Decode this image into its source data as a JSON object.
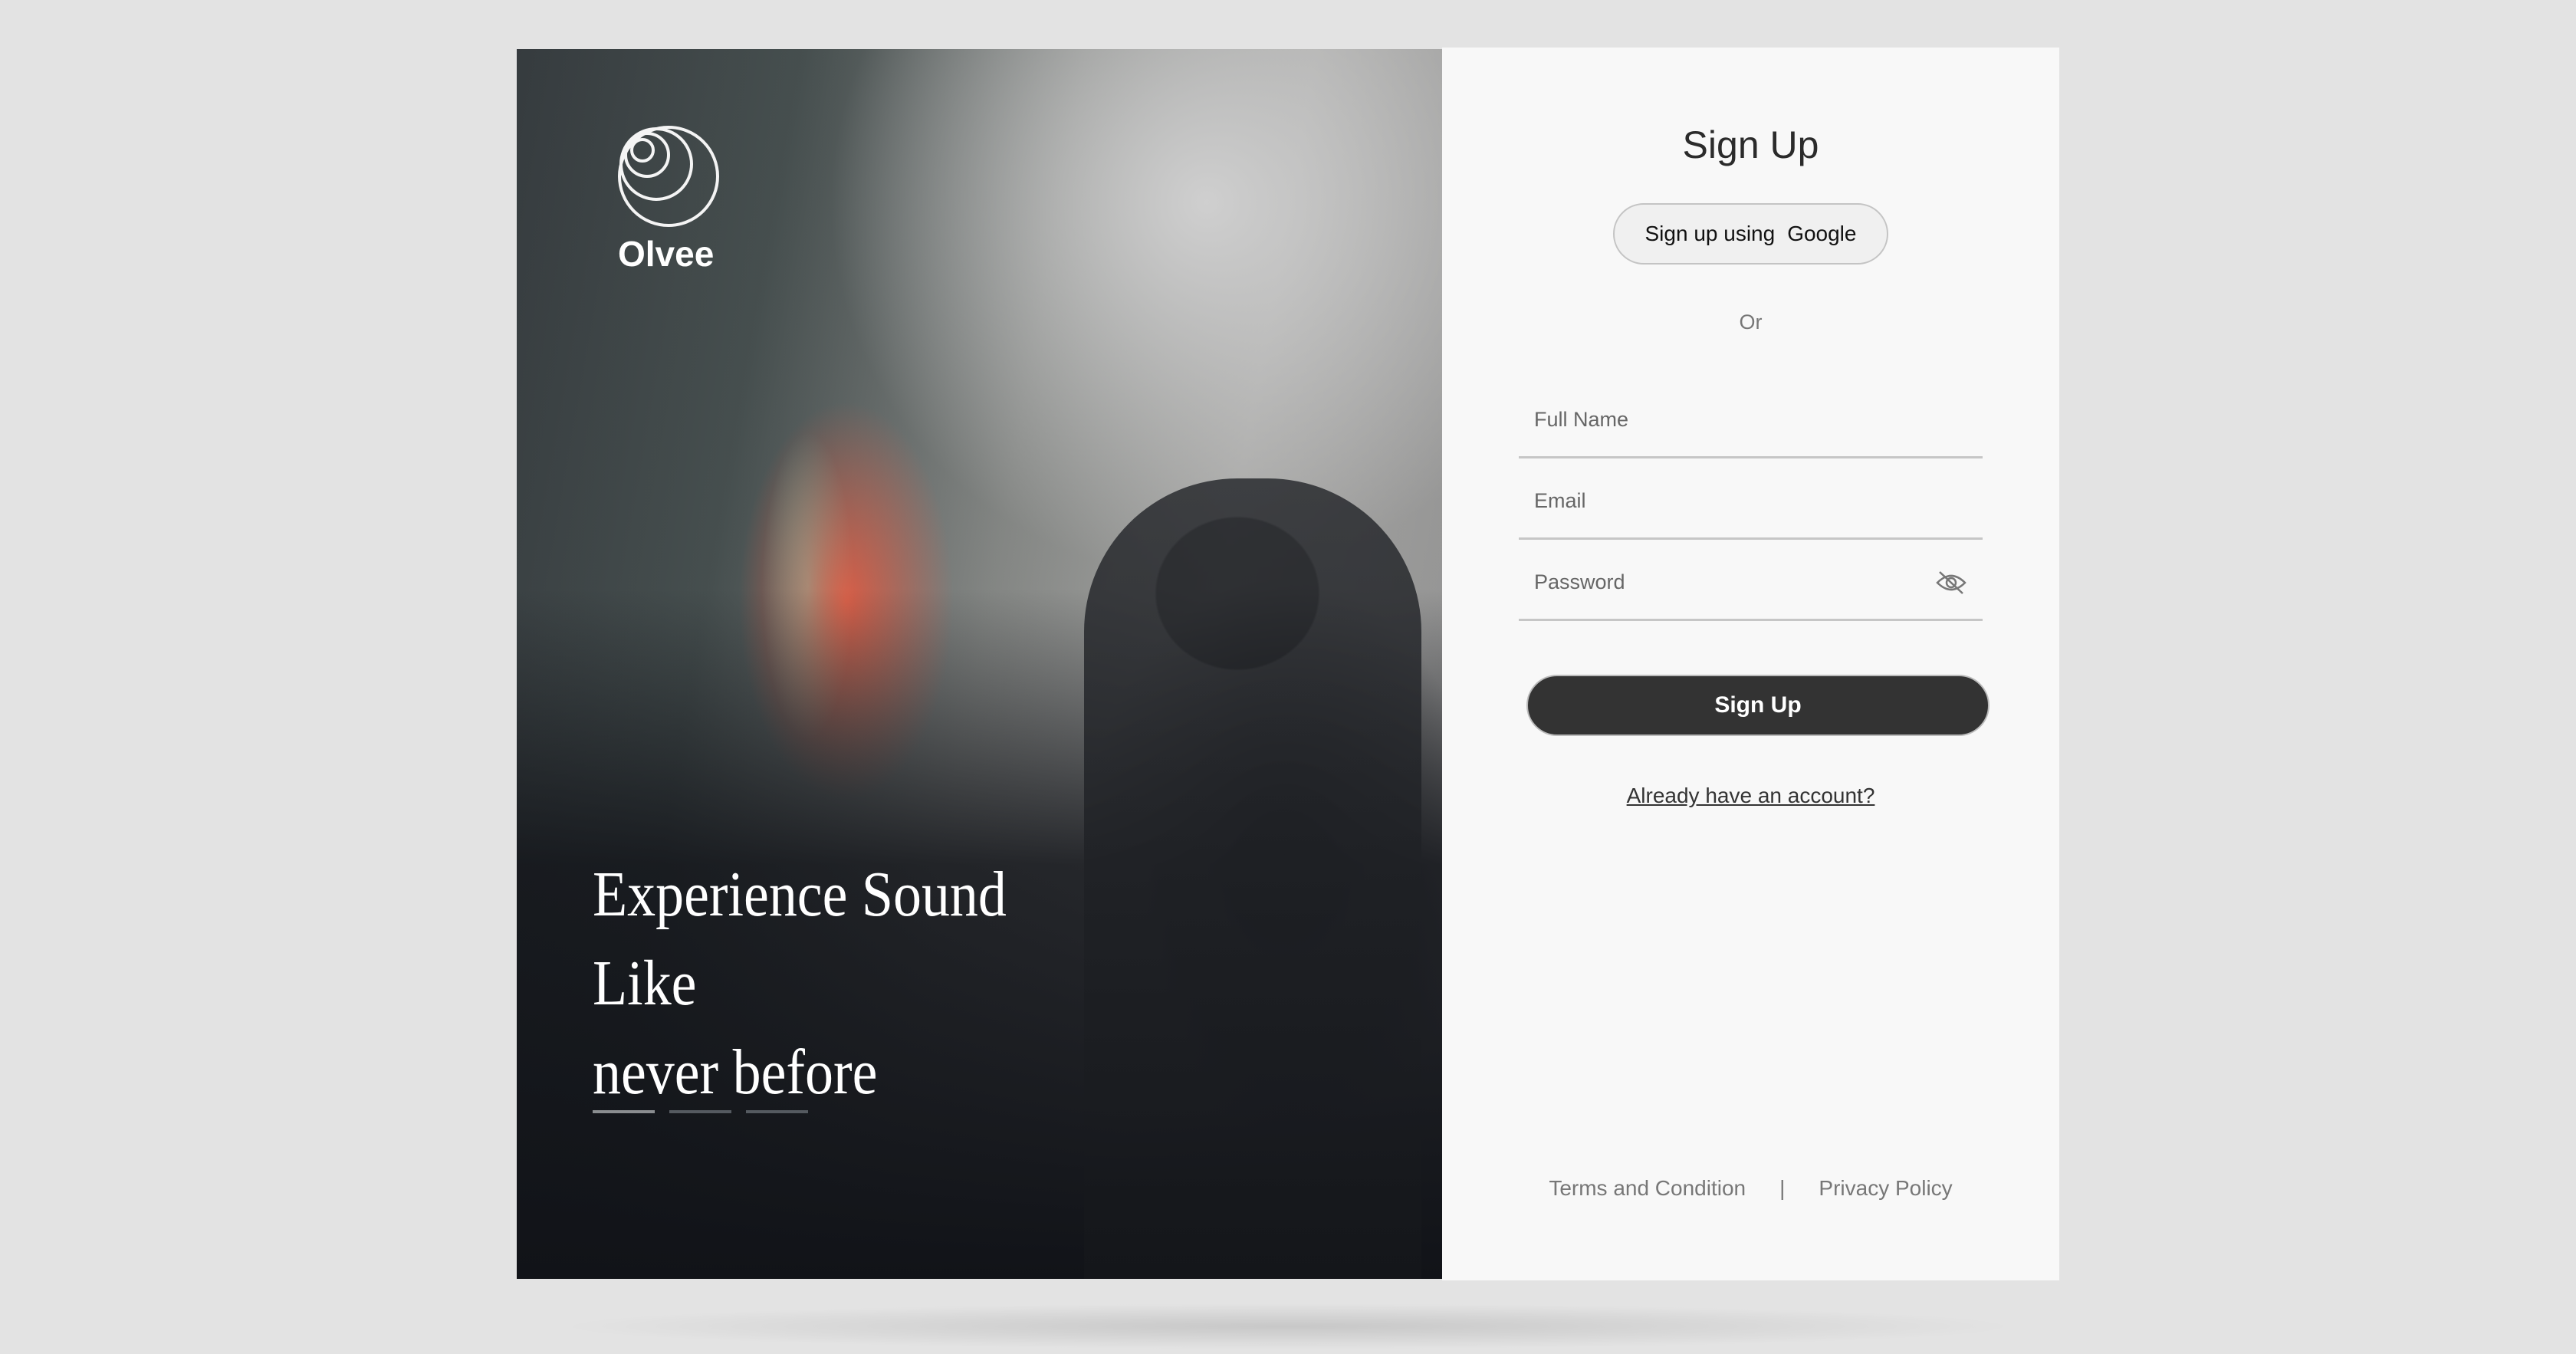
{
  "brand": {
    "name": "Olvee"
  },
  "hero": {
    "headline_line1": "Experience Sound Like",
    "headline_line2": "never before",
    "carousel": {
      "count": 3,
      "active": 0
    }
  },
  "signup": {
    "title": "Sign Up",
    "google_prefix": "Sign up using",
    "google_label": "Google",
    "or": "Or",
    "fields": [
      {
        "placeholder": "Full Name"
      },
      {
        "placeholder": "Email"
      },
      {
        "placeholder": "Password",
        "icon": "eye-off-icon"
      }
    ],
    "submit": "Sign Up",
    "login_link": "Already have an account?"
  },
  "footer": {
    "terms": "Terms and Condition",
    "separator": "|",
    "privacy": "Privacy Policy"
  }
}
